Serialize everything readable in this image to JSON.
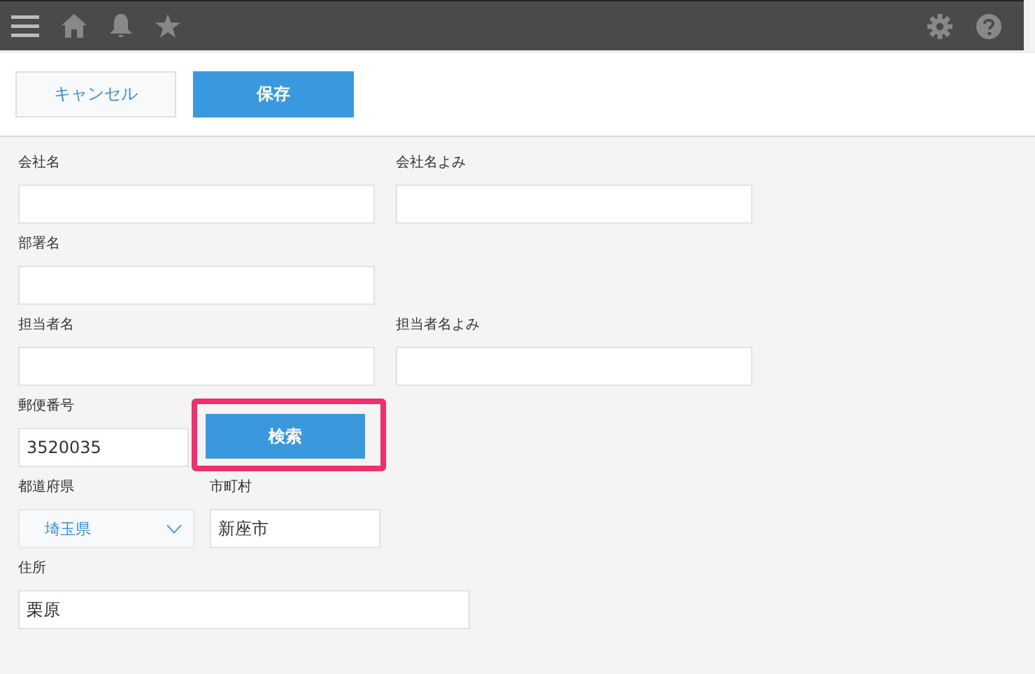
{
  "toolbar": {
    "buttons": [
      {
        "label": "キャンセル",
        "kind": "secondary"
      },
      {
        "label": "保存",
        "kind": "primary"
      }
    ]
  },
  "form": {
    "rows": [
      {
        "kind": "pair",
        "fields": [
          {
            "label": "会社名"
          },
          {
            "label": "会社名よみ"
          }
        ]
      },
      {
        "kind": "pair",
        "fields": [
          {
            "label": "部署名"
          }
        ]
      },
      {
        "kind": "pair",
        "fields": [
          {
            "label": "担当者名"
          },
          {
            "label": "担当者名よみ"
          }
        ]
      },
      {
        "kind": "zip",
        "fields": [
          {
            "label": "郵便番号",
            "value": "3520035"
          }
        ],
        "button": {
          "label": "検索",
          "highlighted": true
        }
      },
      {
        "kind": "pref_city",
        "fields": [
          {
            "label": "都道府県",
            "value": "埼玉県",
            "kind": "select"
          },
          {
            "label": "市町村",
            "value": "新座市"
          }
        ]
      },
      {
        "kind": "address",
        "fields": [
          {
            "label": "住所",
            "value": "栗原"
          }
        ]
      }
    ]
  }
}
